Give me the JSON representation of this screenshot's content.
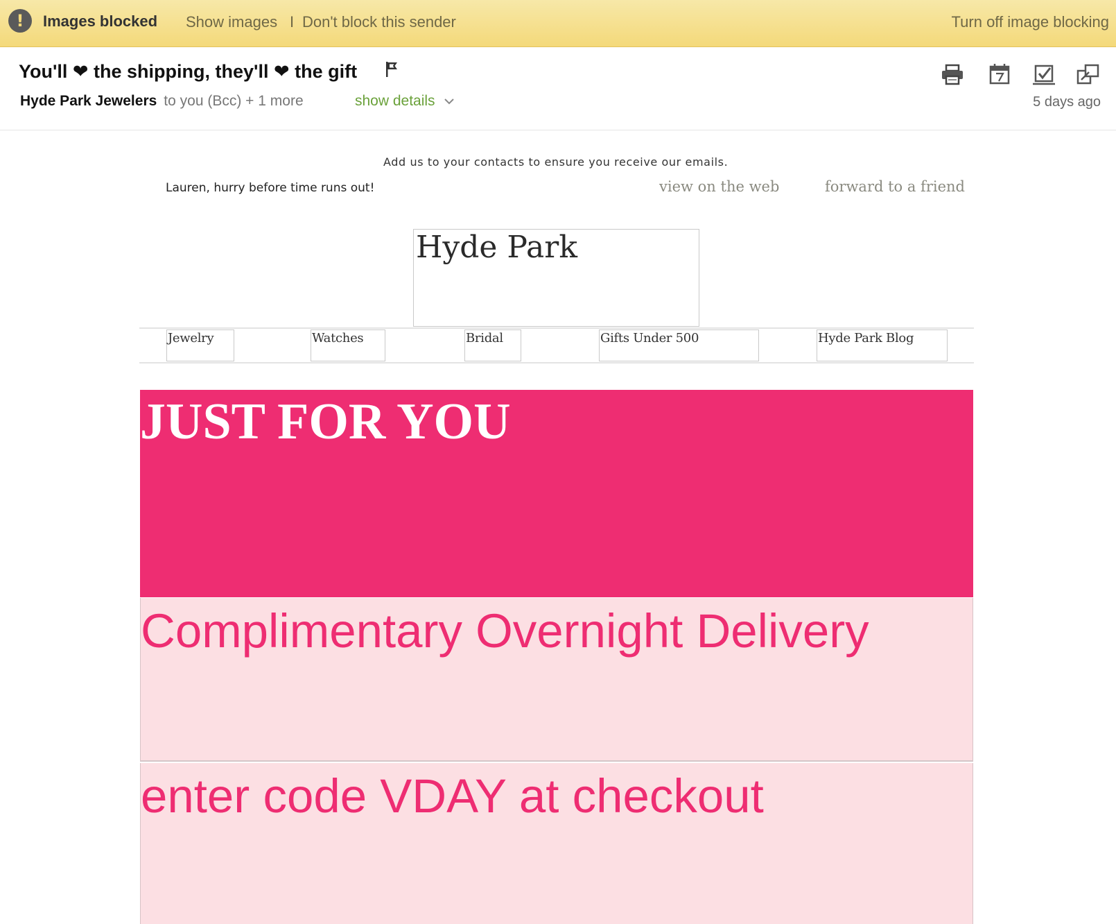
{
  "banner": {
    "status": "Images blocked",
    "show_images": "Show images",
    "separator": "I",
    "dont_block": "Don't block this sender",
    "turn_off": "Turn off image blocking",
    "icon": "warning-icon"
  },
  "message": {
    "subject": "You'll ❤ the shipping, they'll ❤ the gift",
    "sender": "Hyde Park Jewelers",
    "recipients": "to you (Bcc) + 1 more",
    "show_details": "show details",
    "date": "5 days ago",
    "toolbar_icons": [
      "print-icon",
      "calendar-icon",
      "task-icon",
      "popout-icon"
    ]
  },
  "email": {
    "add_contacts": "Add us to your contacts to ensure you receive our emails.",
    "preheader": "Lauren, hurry before time runs out!",
    "view_web": "view on the web",
    "forward": "forward to a friend",
    "logo_alt": "Hyde Park",
    "nav": [
      "Jewelry",
      "Watches",
      "Bridal",
      "Gifts Under 500",
      "Hyde Park Blog"
    ],
    "hero_alt": "JUST FOR YOU",
    "promo_1": "Complimentary Overnight Delivery",
    "promo_2": "enter code VDAY at checkout"
  },
  "colors": {
    "banner": "#f4d97a",
    "brand_pink": "#ee2d72",
    "promo_bg": "#fcdfe3",
    "link_green": "#6aa13a"
  }
}
